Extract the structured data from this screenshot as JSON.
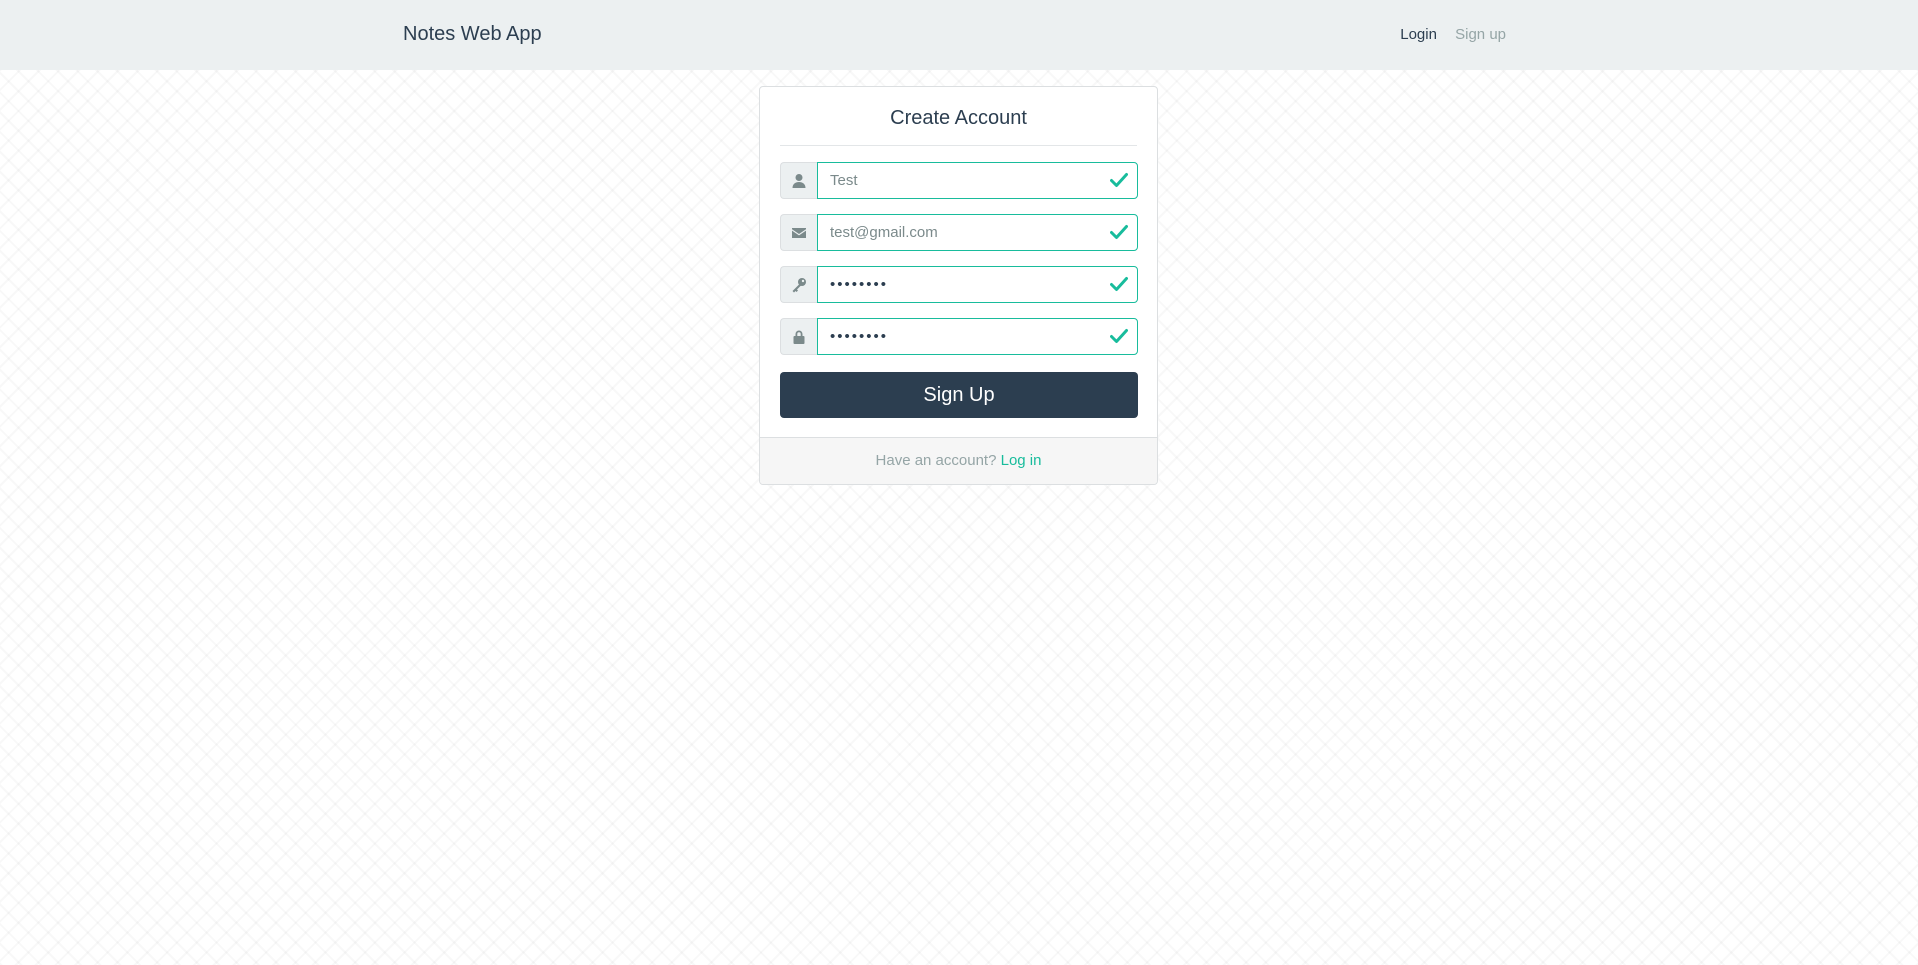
{
  "navbar": {
    "brand": "Notes Web App",
    "login_label": "Login",
    "signup_label": "Sign up"
  },
  "form": {
    "title": "Create Account",
    "fields": [
      {
        "name": "username",
        "icon": "user-icon",
        "value": "Test"
      },
      {
        "name": "email",
        "icon": "envelope-icon",
        "value": "test@gmail.com"
      },
      {
        "name": "password",
        "icon": "key-icon",
        "value": "••••••••"
      },
      {
        "name": "confirm-password",
        "icon": "lock-icon",
        "value": "••••••••"
      }
    ],
    "submit_label": "Sign Up",
    "footer_text": "Have an account?",
    "footer_link": "Log in"
  },
  "colors": {
    "primary": "#2c3e50",
    "success": "#18bc9c",
    "navbar_bg": "#ecf0f1",
    "muted": "#95a5a6"
  }
}
